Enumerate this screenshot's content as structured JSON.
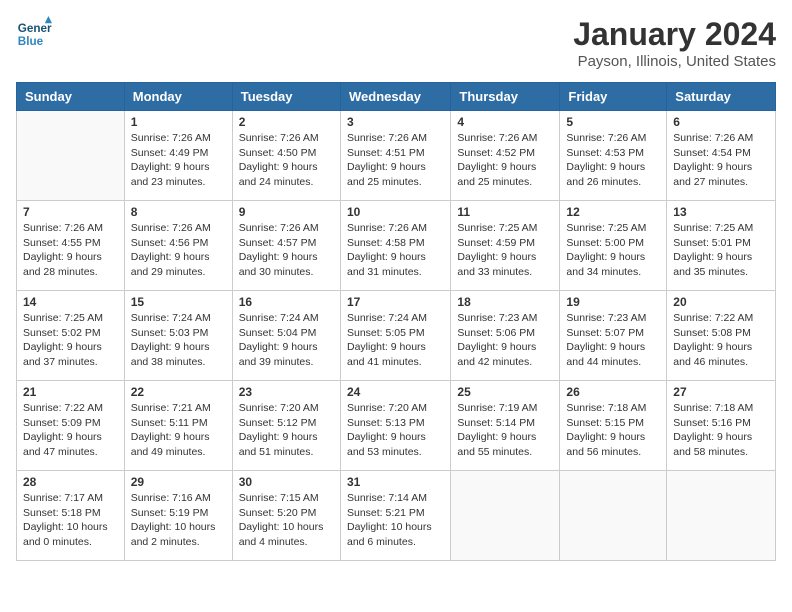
{
  "header": {
    "logo_line1": "General",
    "logo_line2": "Blue",
    "title": "January 2024",
    "subtitle": "Payson, Illinois, United States"
  },
  "days_of_week": [
    "Sunday",
    "Monday",
    "Tuesday",
    "Wednesday",
    "Thursday",
    "Friday",
    "Saturday"
  ],
  "weeks": [
    [
      {
        "day": "",
        "content": ""
      },
      {
        "day": "1",
        "content": "Sunrise: 7:26 AM\nSunset: 4:49 PM\nDaylight: 9 hours\nand 23 minutes."
      },
      {
        "day": "2",
        "content": "Sunrise: 7:26 AM\nSunset: 4:50 PM\nDaylight: 9 hours\nand 24 minutes."
      },
      {
        "day": "3",
        "content": "Sunrise: 7:26 AM\nSunset: 4:51 PM\nDaylight: 9 hours\nand 25 minutes."
      },
      {
        "day": "4",
        "content": "Sunrise: 7:26 AM\nSunset: 4:52 PM\nDaylight: 9 hours\nand 25 minutes."
      },
      {
        "day": "5",
        "content": "Sunrise: 7:26 AM\nSunset: 4:53 PM\nDaylight: 9 hours\nand 26 minutes."
      },
      {
        "day": "6",
        "content": "Sunrise: 7:26 AM\nSunset: 4:54 PM\nDaylight: 9 hours\nand 27 minutes."
      }
    ],
    [
      {
        "day": "7",
        "content": "Sunrise: 7:26 AM\nSunset: 4:55 PM\nDaylight: 9 hours\nand 28 minutes."
      },
      {
        "day": "8",
        "content": "Sunrise: 7:26 AM\nSunset: 4:56 PM\nDaylight: 9 hours\nand 29 minutes."
      },
      {
        "day": "9",
        "content": "Sunrise: 7:26 AM\nSunset: 4:57 PM\nDaylight: 9 hours\nand 30 minutes."
      },
      {
        "day": "10",
        "content": "Sunrise: 7:26 AM\nSunset: 4:58 PM\nDaylight: 9 hours\nand 31 minutes."
      },
      {
        "day": "11",
        "content": "Sunrise: 7:25 AM\nSunset: 4:59 PM\nDaylight: 9 hours\nand 33 minutes."
      },
      {
        "day": "12",
        "content": "Sunrise: 7:25 AM\nSunset: 5:00 PM\nDaylight: 9 hours\nand 34 minutes."
      },
      {
        "day": "13",
        "content": "Sunrise: 7:25 AM\nSunset: 5:01 PM\nDaylight: 9 hours\nand 35 minutes."
      }
    ],
    [
      {
        "day": "14",
        "content": "Sunrise: 7:25 AM\nSunset: 5:02 PM\nDaylight: 9 hours\nand 37 minutes."
      },
      {
        "day": "15",
        "content": "Sunrise: 7:24 AM\nSunset: 5:03 PM\nDaylight: 9 hours\nand 38 minutes."
      },
      {
        "day": "16",
        "content": "Sunrise: 7:24 AM\nSunset: 5:04 PM\nDaylight: 9 hours\nand 39 minutes."
      },
      {
        "day": "17",
        "content": "Sunrise: 7:24 AM\nSunset: 5:05 PM\nDaylight: 9 hours\nand 41 minutes."
      },
      {
        "day": "18",
        "content": "Sunrise: 7:23 AM\nSunset: 5:06 PM\nDaylight: 9 hours\nand 42 minutes."
      },
      {
        "day": "19",
        "content": "Sunrise: 7:23 AM\nSunset: 5:07 PM\nDaylight: 9 hours\nand 44 minutes."
      },
      {
        "day": "20",
        "content": "Sunrise: 7:22 AM\nSunset: 5:08 PM\nDaylight: 9 hours\nand 46 minutes."
      }
    ],
    [
      {
        "day": "21",
        "content": "Sunrise: 7:22 AM\nSunset: 5:09 PM\nDaylight: 9 hours\nand 47 minutes."
      },
      {
        "day": "22",
        "content": "Sunrise: 7:21 AM\nSunset: 5:11 PM\nDaylight: 9 hours\nand 49 minutes."
      },
      {
        "day": "23",
        "content": "Sunrise: 7:20 AM\nSunset: 5:12 PM\nDaylight: 9 hours\nand 51 minutes."
      },
      {
        "day": "24",
        "content": "Sunrise: 7:20 AM\nSunset: 5:13 PM\nDaylight: 9 hours\nand 53 minutes."
      },
      {
        "day": "25",
        "content": "Sunrise: 7:19 AM\nSunset: 5:14 PM\nDaylight: 9 hours\nand 55 minutes."
      },
      {
        "day": "26",
        "content": "Sunrise: 7:18 AM\nSunset: 5:15 PM\nDaylight: 9 hours\nand 56 minutes."
      },
      {
        "day": "27",
        "content": "Sunrise: 7:18 AM\nSunset: 5:16 PM\nDaylight: 9 hours\nand 58 minutes."
      }
    ],
    [
      {
        "day": "28",
        "content": "Sunrise: 7:17 AM\nSunset: 5:18 PM\nDaylight: 10 hours\nand 0 minutes."
      },
      {
        "day": "29",
        "content": "Sunrise: 7:16 AM\nSunset: 5:19 PM\nDaylight: 10 hours\nand 2 minutes."
      },
      {
        "day": "30",
        "content": "Sunrise: 7:15 AM\nSunset: 5:20 PM\nDaylight: 10 hours\nand 4 minutes."
      },
      {
        "day": "31",
        "content": "Sunrise: 7:14 AM\nSunset: 5:21 PM\nDaylight: 10 hours\nand 6 minutes."
      },
      {
        "day": "",
        "content": ""
      },
      {
        "day": "",
        "content": ""
      },
      {
        "day": "",
        "content": ""
      }
    ]
  ]
}
